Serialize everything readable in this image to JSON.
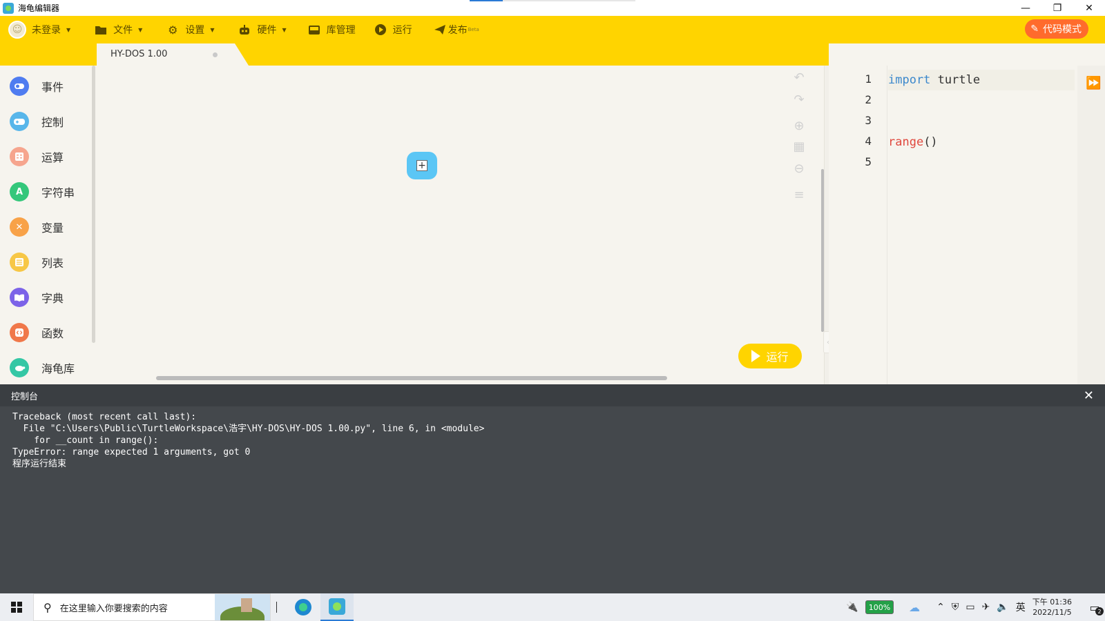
{
  "window": {
    "title": "海龟编辑器",
    "controls": [
      "—",
      "❐",
      "✕"
    ]
  },
  "toolbar": {
    "login": "未登录",
    "file": "文件",
    "settings": "设置",
    "hardware": "硬件",
    "library": "库管理",
    "run": "运行",
    "publish": "发布",
    "publish_badge": "Beta",
    "code_mode": "代码模式"
  },
  "tab": {
    "label": "HY-DOS 1.00"
  },
  "sidebar": {
    "items": [
      {
        "label": "事件",
        "color": "#4f7cf0",
        "icon": "toggle-icon"
      },
      {
        "label": "控制",
        "color": "#58b6ea",
        "icon": "gamepad-icon"
      },
      {
        "label": "运算",
        "color": "#f6a58e",
        "icon": "calculator-icon"
      },
      {
        "label": "字符串",
        "color": "#34c77b",
        "icon": "letter-a-icon"
      },
      {
        "label": "变量",
        "color": "#f8a248",
        "icon": "variable-x-icon"
      },
      {
        "label": "列表",
        "color": "#f7c746",
        "icon": "list-icon"
      },
      {
        "label": "字典",
        "color": "#7c63e8",
        "icon": "book-icon"
      },
      {
        "label": "函数",
        "color": "#f0784a",
        "icon": "function-icon"
      },
      {
        "label": "海龟库",
        "color": "#34c7a5",
        "icon": "turtle-icon"
      }
    ]
  },
  "canvas": {
    "run_button": "运行"
  },
  "editor": {
    "lines": [
      "1",
      "2",
      "3",
      "4",
      "5"
    ],
    "code": {
      "line1_kw": "import",
      "line1_rest": " turtle",
      "line4_fn": "range",
      "line4_rest": "()"
    }
  },
  "console": {
    "title": "控制台",
    "lines": [
      "Traceback (most recent call last):",
      "  File \"C:\\Users\\Public\\TurtleWorkspace\\浩宇\\HY-DOS\\HY-DOS 1.00.py\", line 6, in <module>",
      "    for __count in range():",
      "TypeError: range expected 1 arguments, got 0",
      "程序运行结束"
    ]
  },
  "taskbar": {
    "search_placeholder": "在这里输入你要搜索的内容",
    "battery": "100%",
    "ime": "英",
    "time": "下午 01:36",
    "date": "2022/11/5",
    "notifications": "2"
  }
}
